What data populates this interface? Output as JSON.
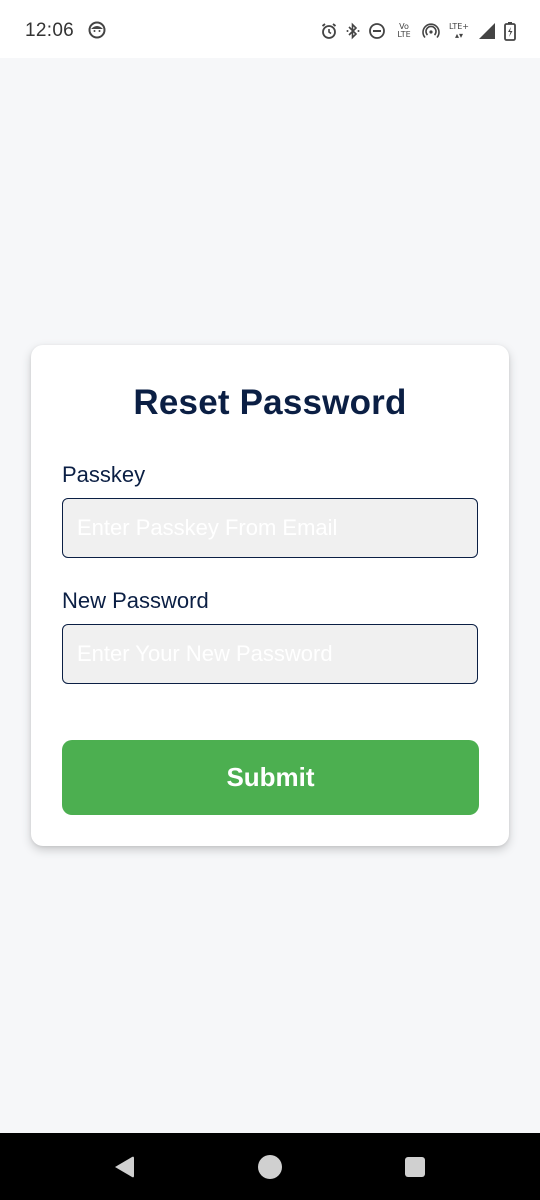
{
  "status_bar": {
    "time": "12:06",
    "volte_top": "Vo",
    "volte_bottom": "LTE",
    "network": "LTE+",
    "icons": [
      "face-icon",
      "alarm-icon",
      "bluetooth-icon",
      "do-not-disturb-icon",
      "volte-icon",
      "hotspot-icon",
      "lte-plus-icon",
      "signal-icon",
      "battery-icon"
    ]
  },
  "form": {
    "title": "Reset Password",
    "passkey": {
      "label": "Passkey",
      "placeholder": "Enter Passkey From Email",
      "value": ""
    },
    "new_password": {
      "label": "New Password",
      "placeholder": "Enter Your New Password",
      "value": ""
    },
    "submit_label": "Submit"
  },
  "nav_bar": {
    "buttons": [
      "back-icon",
      "home-icon",
      "recents-icon"
    ]
  },
  "colors": {
    "title": "#0b1f44",
    "submit": "#4caf50",
    "background": "#f6f7f9",
    "input_bg": "#f0f0f0"
  }
}
